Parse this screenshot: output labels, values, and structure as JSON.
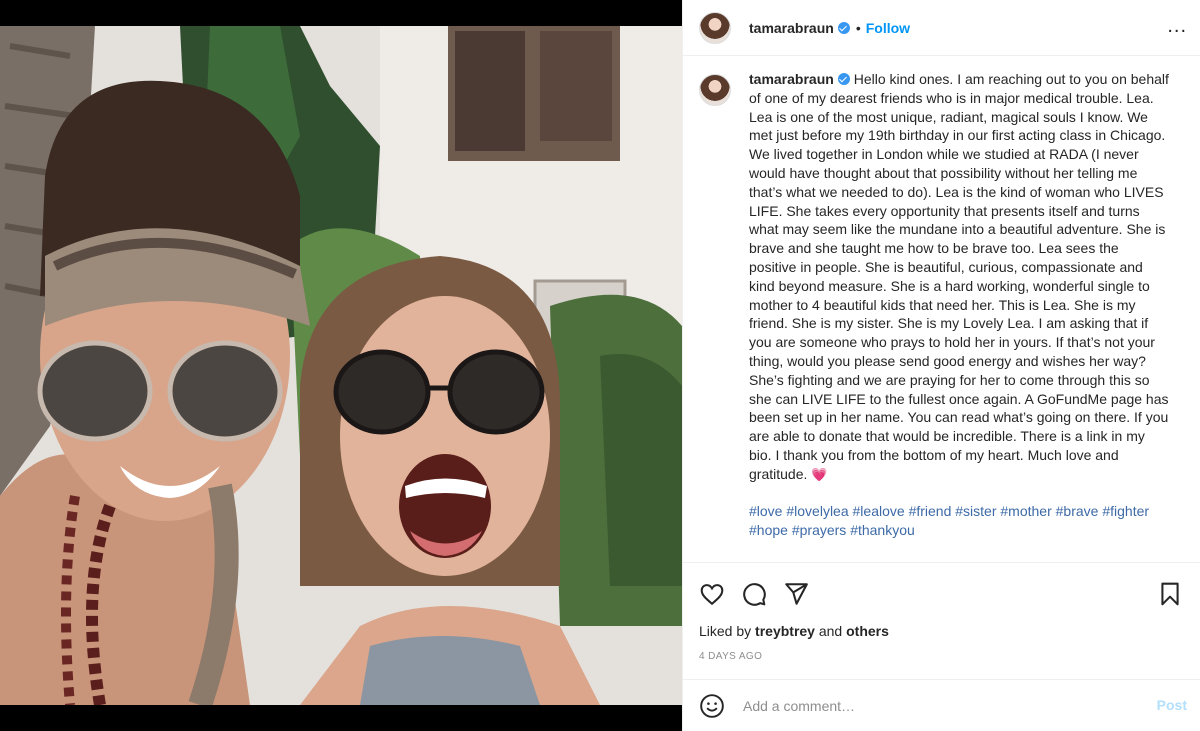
{
  "post": {
    "author": {
      "username": "tamarabraun",
      "verified": true,
      "follow_label": "Follow",
      "dot": "•",
      "more_label": "..."
    },
    "caption": {
      "username": "tamarabraun",
      "text": "Hello kind ones. I am reaching out to you on behalf of one of my dearest friends who is in major medical trouble. Lea. Lea is one of the most unique, radiant, magical souls I know. We met just before my 19th birthday in our first acting class in Chicago. We lived together in London while we studied at RADA (I never would have thought about that possibility without her telling me that’s what we needed to do). Lea is the kind of woman who LIVES LIFE. She takes every opportunity that presents itself and turns what may seem like the mundane into a beautiful adventure. She is brave and she taught me how to be brave too. Lea sees the positive in people. She is beautiful, curious, compassionate and kind beyond measure. She is a hard working, wonderful single to mother to 4 beautiful kids that need her. This is Lea. She is my friend. She is my sister. She is my Lovely Lea. I am asking that if you are someone who prays to hold her in yours. If that’s not your thing, would you please send good energy and wishes her way? She’s fighting and we are praying for her to come through this so she can LIVE LIFE to the fullest once again. A GoFundMe page has been set up in her name. You can read what’s going on there. If you are able to donate that would be incredible. There is a link in my bio. I thank you from the bottom of my heart. Much love and gratitude.",
      "emoji": "💗",
      "hashtags": [
        "#love",
        "#lovelylea",
        "#lealove",
        "#friend",
        "#sister",
        "#mother",
        "#brave",
        "#fighter",
        "#hope",
        "#prayers",
        "#thankyou"
      ]
    },
    "actions": {
      "like_icon": "heart-outline-icon",
      "comment_icon": "comment-icon",
      "share_icon": "send-icon",
      "save_icon": "bookmark-icon"
    },
    "likes": {
      "prefix": "Liked by",
      "user": "treybtrey",
      "middle": "and",
      "others": "others"
    },
    "date": "4 DAYS AGO",
    "comment": {
      "emoji_icon": "smiley-icon",
      "placeholder": "Add a comment…",
      "post_label": "Post"
    }
  },
  "colors": {
    "accent": "#0095f6",
    "hashtag": "#00376b",
    "verified": "#3897f0",
    "post_disabled": "#b2dffc",
    "muted": "#8e8e8e"
  }
}
